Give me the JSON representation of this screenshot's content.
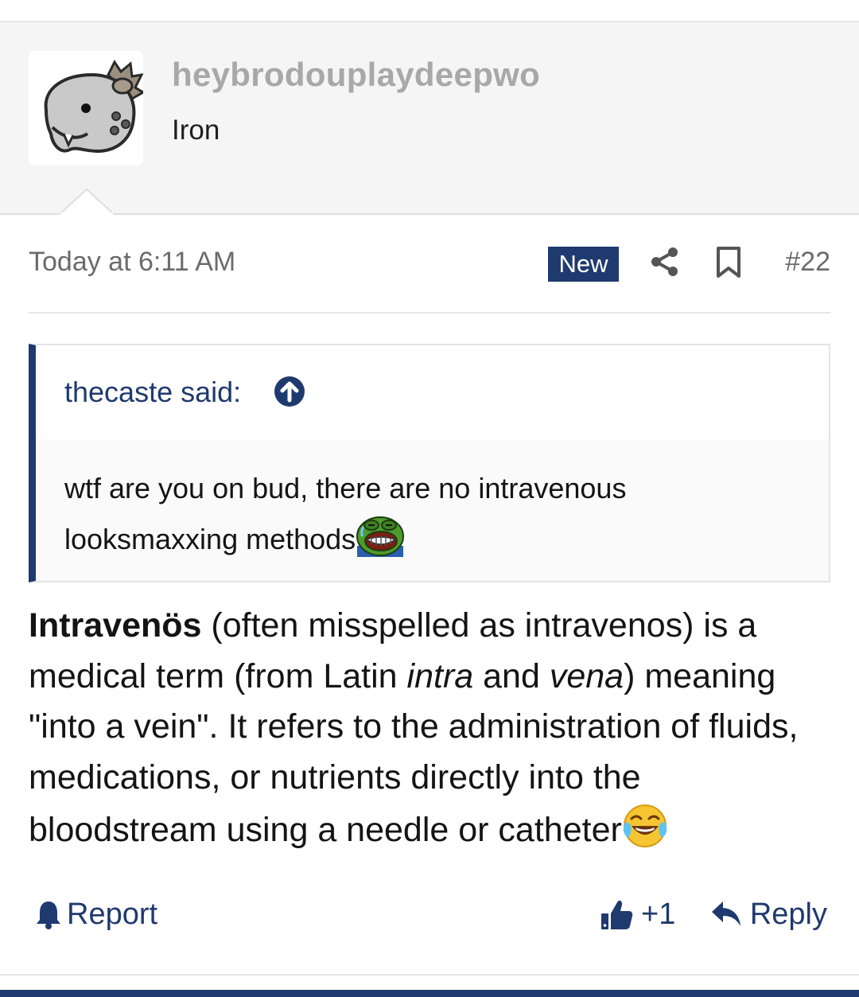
{
  "user": {
    "username": "heybrodouplaydeepwo",
    "rank": "Iron",
    "avatar_icon": "grey-pokemon-avatar"
  },
  "post": {
    "date": "Today at 6:11 AM",
    "badge": "New",
    "number": "#22",
    "share_icon": "share-icon",
    "bookmark_icon": "bookmark-icon"
  },
  "quote": {
    "author_label": "thecaste said:",
    "line1": "wtf are you on bud, there are no intravenous",
    "line2": "looksmaxxing methods",
    "emoji": "pepe-laughing-emoji"
  },
  "body": {
    "term": "Intravenös",
    "part1": " (often misspelled as intravenos) is a medical term (from Latin ",
    "latin1": "intra",
    "part2": " and ",
    "latin2": "vena",
    "part3": ") meaning \"into a vein\". It refers to the administration of fluids, medications, or nutrients directly into the bloodstream using a needle or catheter",
    "emoji": "face-with-tears-of-joy-emoji"
  },
  "actions": {
    "report": "Report",
    "like_count": "+1",
    "reply": "Reply"
  },
  "colors": {
    "accent": "#1f3a6e",
    "username": "#a8a8a8",
    "meta_text": "#6b6b6b"
  }
}
